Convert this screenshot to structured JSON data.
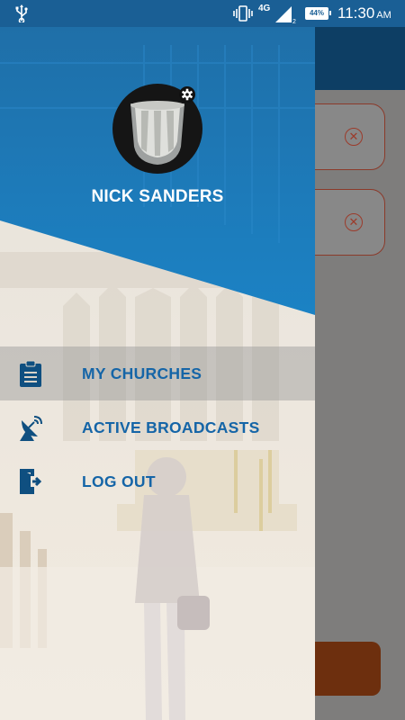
{
  "status_bar": {
    "network": "4G",
    "signal_sub": "2",
    "battery": "44%",
    "time": "11:30",
    "ampm": "AM",
    "icons": [
      "usb-icon",
      "vibrate-icon",
      "signal-icon",
      "battery-icon"
    ]
  },
  "drawer": {
    "user_name": "NICK SANDERS",
    "menu": [
      {
        "label": "MY CHURCHES",
        "icon": "clipboard-icon",
        "active": true
      },
      {
        "label": "ACTIVE BROADCASTS",
        "icon": "satellite-dish-icon",
        "active": false
      },
      {
        "label": "LOG OUT",
        "icon": "logout-icon",
        "active": false
      }
    ]
  },
  "colors": {
    "header_blue": "#1a78b8",
    "status_bar": "#1a5f95",
    "menu_text": "#1565a7",
    "app_bar": "#0d3e64",
    "accent_button": "#6d2f0e"
  }
}
